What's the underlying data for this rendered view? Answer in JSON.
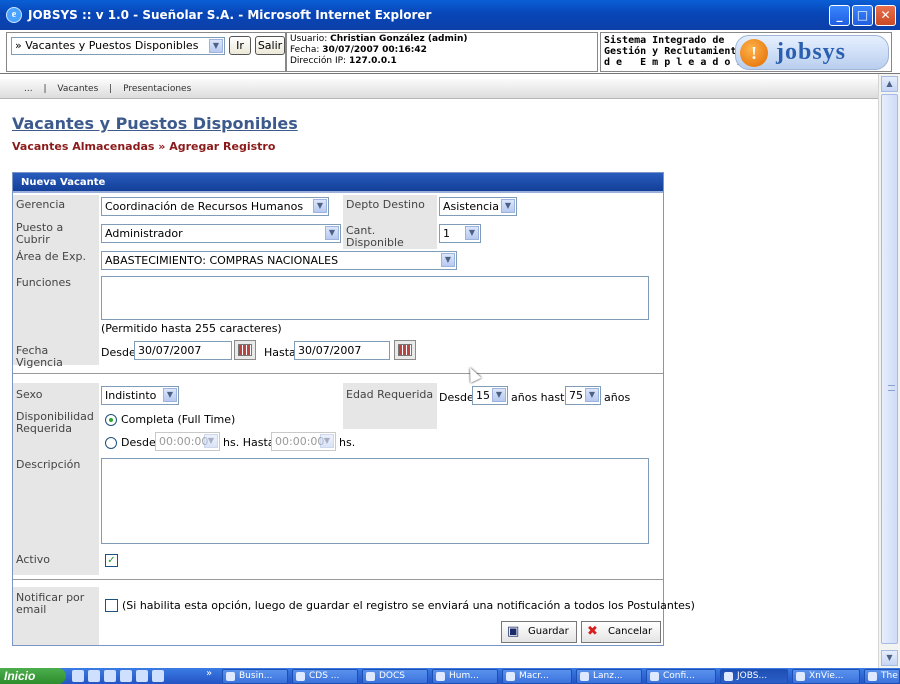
{
  "window": {
    "title": "JOBSYS :: v 1.0 - Sueñolar S.A. - Microsoft Internet Explorer",
    "min": "_",
    "max": "□",
    "close": "✕"
  },
  "header": {
    "section_select": "» Vacantes y Puestos Disponibles",
    "ir_label": "Ir",
    "salir_label": "Salir",
    "user_label": "Usuario:",
    "user_value": "Christian González (admin)",
    "date_label": "Fecha:",
    "date_value": "30/07/2007 00:16:42",
    "ip_label": "Dirección IP:",
    "ip_value": "127.0.0.1",
    "brand_line1": "Sistema Integrado de",
    "brand_line2": "Gestión y Reclutamiento",
    "brand_line3": "d e   E m p l e a d o s",
    "logo_text": "jobsys"
  },
  "nav": {
    "items": [
      "...",
      "|",
      "Vacantes",
      "|",
      "Presentaciones"
    ]
  },
  "page": {
    "title": "Vacantes y Puestos Disponibles",
    "breadcrumb": "Vacantes Almacenadas » Agregar Registro"
  },
  "form": {
    "heading": "Nueva Vacante",
    "gerencia_label": "Gerencia",
    "gerencia_value": "Coordinación de Recursos Humanos",
    "depto_label": "Depto Destino",
    "depto_value": "Asistencia",
    "puesto_label": "Puesto a Cubrir",
    "puesto_value": "Administrador",
    "cant_label": "Cant. Disponible",
    "cant_value": "1",
    "area_label": "Área de Exp.",
    "area_value": "ABASTECIMIENTO: COMPRAS NACIONALES",
    "funciones_label": "Funciones",
    "funciones_hint": "(Permitido hasta 255 caracteres)",
    "vigencia_label": "Fecha Vigencia",
    "desde_label": "Desde",
    "desde_value": "30/07/2007",
    "hasta_label": "Hasta",
    "hasta_value": "30/07/2007",
    "sexo_label": "Sexo",
    "sexo_value": "Indistinto",
    "edad_label": "Edad Requerida",
    "edad_desde_label": "Desde",
    "edad_desde_value": "15",
    "edad_mid": "años hasta",
    "edad_hasta_value": "75",
    "edad_suffix": "años",
    "disp_label": "Disponibilidad Requerida",
    "disp_option1": "Completa (Full Time)",
    "disp_option2_pre": "Desde",
    "disp_time1": "00:00:00",
    "disp_mid": "hs. Hasta",
    "disp_time2": "00:00:00",
    "disp_suffix": "hs.",
    "desc_label": "Descripción",
    "activo_label": "Activo",
    "activo_check": "✓",
    "notif_label": "Notificar por email",
    "notif_text": "(Si habilita esta opción, luego de guardar el registro se enviará una notificación a todos los Postulantes)",
    "guardar_label": "Guardar",
    "cancelar_label": "Cancelar"
  },
  "taskbar": {
    "start": "Inicio",
    "tasks": [
      "Busin...",
      "CDS ...",
      "DOCS",
      "Hum...",
      "Macr...",
      "Lanz...",
      "Confi...",
      "JOBS...",
      "XnVie...",
      "The"
    ],
    "more": "»"
  },
  "colors": {
    "title_blue": "#3c5a8c",
    "breadcrumb_red": "#8b1a1a",
    "form_head": "#123f98"
  }
}
